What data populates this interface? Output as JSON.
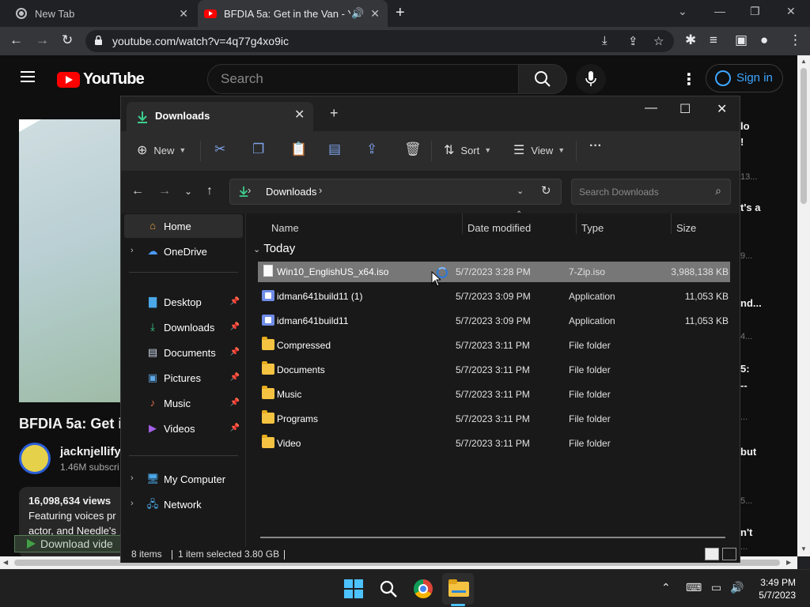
{
  "chrome": {
    "tabs": [
      {
        "title": "New Tab"
      },
      {
        "title": "BFDIA 5a: Get in the Van - Yo"
      }
    ],
    "url": "youtube.com/watch?v=4q77g4xo9ic"
  },
  "youtube": {
    "logo_text": "YouTube",
    "search_placeholder": "Search",
    "signin_label": "Sign in",
    "video_title": "BFDIA 5a: Get i",
    "channel_name": "jacknjellify",
    "subscribers": "1.46M subscri",
    "views": "16,098,634 views",
    "desc_line1": "Featuring voices pr",
    "desc_line2": "actor, and Needle's",
    "download_button": "Download vide",
    "right_column": [
      "lo",
      "!",
      "13...",
      "t's a",
      "9...",
      "nd...",
      "4...",
      "5:",
      "--",
      "...",
      "but",
      "5...",
      "n't",
      "..."
    ]
  },
  "explorer": {
    "tab_title": "Downloads",
    "toolbar": {
      "new": "New",
      "sort": "Sort",
      "view": "View",
      "more": "···"
    },
    "breadcrumb": "Downloads",
    "search_placeholder": "Search Downloads",
    "nav": {
      "home": "Home",
      "onedrive": "OneDrive",
      "desktop": "Desktop",
      "downloads": "Downloads",
      "documents": "Documents",
      "pictures": "Pictures",
      "music": "Music",
      "videos": "Videos",
      "mycomputer": "My Computer",
      "network": "Network"
    },
    "columns": {
      "name": "Name",
      "date": "Date modified",
      "type": "Type",
      "size": "Size"
    },
    "group": "Today",
    "rows": [
      {
        "name": "Win10_EnglishUS_x64.iso",
        "date": "5/7/2023 3:28 PM",
        "type": "7-Zip.iso",
        "size": "3,988,138 KB",
        "icon": "file-icon"
      },
      {
        "name": "idman641build11 (1)",
        "date": "5/7/2023 3:09 PM",
        "type": "Application",
        "size": "11,053 KB",
        "icon": "app-icon"
      },
      {
        "name": "idman641build11",
        "date": "5/7/2023 3:09 PM",
        "type": "Application",
        "size": "11,053 KB",
        "icon": "app-icon"
      },
      {
        "name": "Compressed",
        "date": "5/7/2023 3:11 PM",
        "type": "File folder",
        "size": "",
        "icon": "folder-icon"
      },
      {
        "name": "Documents",
        "date": "5/7/2023 3:11 PM",
        "type": "File folder",
        "size": "",
        "icon": "folder-icon"
      },
      {
        "name": "Music",
        "date": "5/7/2023 3:11 PM",
        "type": "File folder",
        "size": "",
        "icon": "folder-icon"
      },
      {
        "name": "Programs",
        "date": "5/7/2023 3:11 PM",
        "type": "File folder",
        "size": "",
        "icon": "folder-icon"
      },
      {
        "name": "Video",
        "date": "5/7/2023 3:11 PM",
        "type": "File folder",
        "size": "",
        "icon": "folder-icon"
      }
    ],
    "status": {
      "items": "8 items",
      "selected": "1 item selected  3.80 GB"
    }
  },
  "taskbar": {
    "time": "3:49 PM",
    "date": "5/7/2023"
  }
}
